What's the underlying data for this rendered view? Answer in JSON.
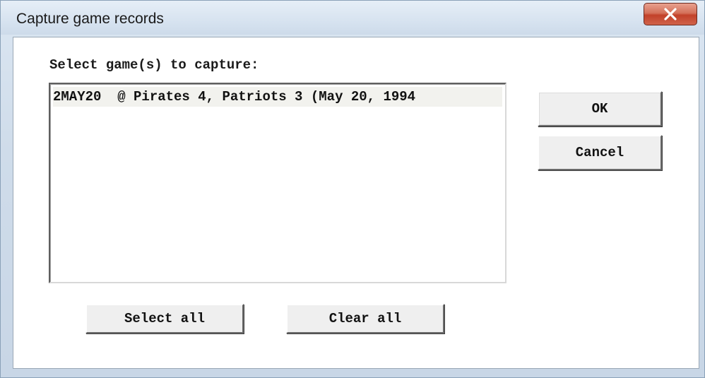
{
  "window": {
    "title": "Capture game records",
    "close_icon": "close-x-icon"
  },
  "dialog": {
    "prompt": "Select game(s) to capture:",
    "games": [
      "2MAY20  @ Pirates 4, Patriots 3 (May 20, 1994"
    ],
    "buttons": {
      "ok": "OK",
      "cancel": "Cancel",
      "select_all": "Select all",
      "clear_all": "Clear all"
    }
  },
  "colors": {
    "close_button": "#c2412a",
    "window_frame": "#cfdcea",
    "client_background": "#ffffff"
  }
}
